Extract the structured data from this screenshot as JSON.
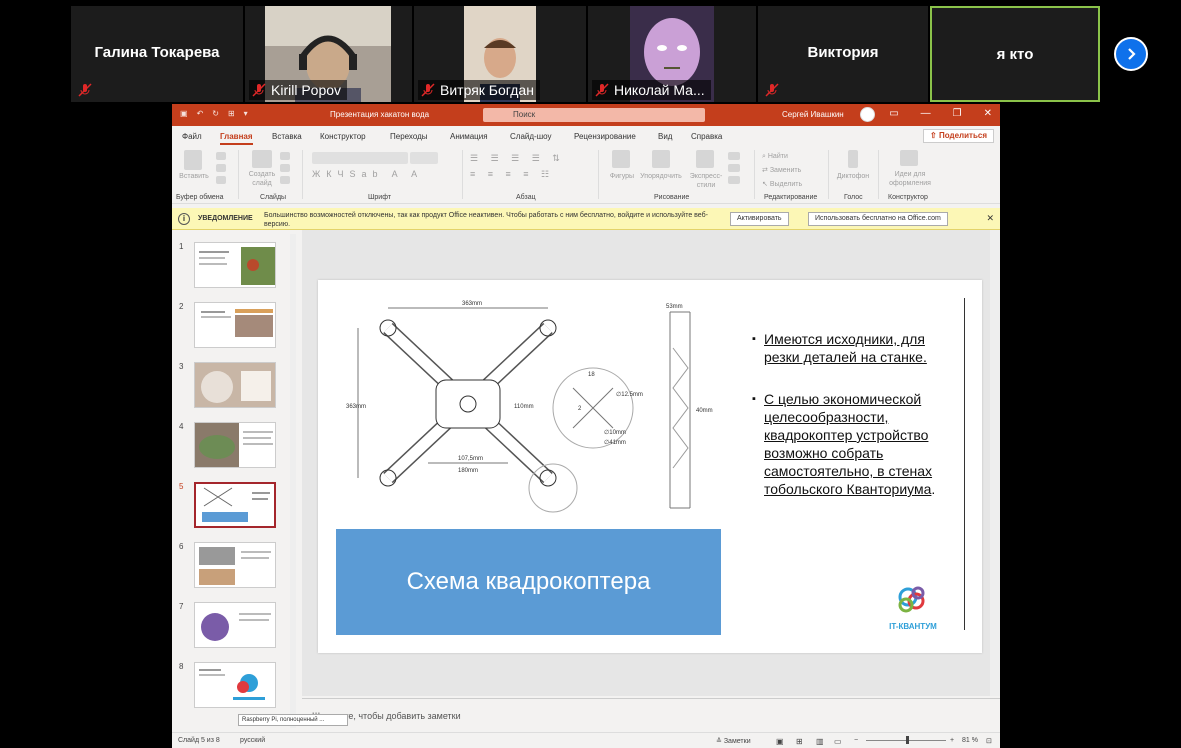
{
  "participants": [
    {
      "name": "Галина Токарева",
      "video": false
    },
    {
      "name": "Kirill Popov",
      "video": true
    },
    {
      "name": "Витряк Богдан",
      "video": true
    },
    {
      "name": "Николай Ма...",
      "video": true
    },
    {
      "name": "Виктория",
      "video": false
    },
    {
      "name": "я кто",
      "video": false,
      "highlighted": true
    }
  ],
  "ppt": {
    "title": "Презентация хакатон вода",
    "search_placeholder": "Поиск",
    "user": "Сергей Ивашкин",
    "tabs": [
      "Файл",
      "Главная",
      "Вставка",
      "Конструктор",
      "Переходы",
      "Анимация",
      "Слайд-шоу",
      "Рецензирование",
      "Вид",
      "Справка"
    ],
    "active_tab": "Главная",
    "share": "Поделиться",
    "ribbon": {
      "paste": "Вставить",
      "create_slide": "Создать слайд",
      "shapes": "Фигуры",
      "arrange": "Упорядочить",
      "express": "Экспресс-стили",
      "find": "Найти",
      "replace": "Заменить",
      "select": "Выделить",
      "dictation": "Диктофон",
      "ideas": "Идеи для оформления",
      "groups": [
        "Буфер обмена",
        "Слайды",
        "Шрифт",
        "Абзац",
        "Рисование",
        "Редактирование",
        "Голос",
        "Конструктор"
      ]
    },
    "notification": {
      "title": "УВЕДОМЛЕНИЕ",
      "message": "Большинство возможностей отключены, так как продукт Office неактивен. Чтобы работать с ним бесплатно, войдите и используйте веб-версию.",
      "activate": "Активировать",
      "use_free": "Использовать бесплатно на Office.com"
    },
    "thumbnails": [
      "1",
      "2",
      "3",
      "4",
      "5",
      "6",
      "7",
      "8"
    ],
    "active_slide": 5,
    "tooltip": "Raspberry Pi, полноценный ...",
    "slide": {
      "caption": "Схема квадрокоптера",
      "bullet1": "Имеются исходники, для резки деталей на станке.",
      "bullet2_a": "С целью экономической целесообразности, квадрокоптер устройство возможно собрать самостоятельно, в стенах тобольского Кванториума",
      "bullet2_b": ".",
      "logo_text": "IT-КВАНТУМ",
      "dims": {
        "top": "363mm",
        "w53": "53mm",
        "d40": "40mm",
        "d107": "107,5mm",
        "d180": "180mm",
        "d110": "110mm",
        "d363v": "363mm",
        "d125": "∅12.5mm",
        "d10": "∅10mm",
        "d41": "∅41mm",
        "d18": "18",
        "d2": "2"
      }
    },
    "notes_placeholder": "Щелкните, чтобы добавить заметки",
    "status": {
      "slide_info": "Слайд 5 из 8",
      "language": "русский",
      "notes": "Заметки",
      "zoom": "81 %"
    }
  }
}
